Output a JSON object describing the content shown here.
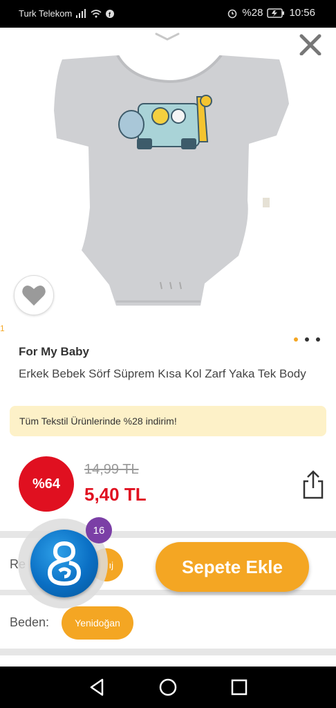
{
  "status_bar": {
    "carrier": "Turk Telekom",
    "battery": "%28",
    "time": "10:56"
  },
  "header": {
    "collapse_icon": "chevron-down-icon",
    "close_icon": "close-icon"
  },
  "gallery": {
    "image_counter": "1",
    "total_images": 3,
    "active_index": 0
  },
  "product": {
    "brand": "For My Baby",
    "title": "Erkek Bebek Sörf Süprem Kısa Kol Zarf Yaka Tek Body",
    "promo": "Tüm Tekstil Ürünlerinde %28 indirim!",
    "discount_badge": "%64",
    "old_price": "14,99 TL",
    "new_price": "5,40 TL"
  },
  "options": {
    "color_label": "Re",
    "color_value": "ıj",
    "size_label": "Beden:",
    "size_value": "Yenidoğan"
  },
  "actions": {
    "add_to_cart": "Sepete Ekle"
  },
  "floating_bubble": {
    "badge_count": "16"
  },
  "colors": {
    "accent": "#f4a623",
    "price_red": "#e01020",
    "promo_bg": "#fdf1c8",
    "badge_purple": "#7b3fa6"
  }
}
